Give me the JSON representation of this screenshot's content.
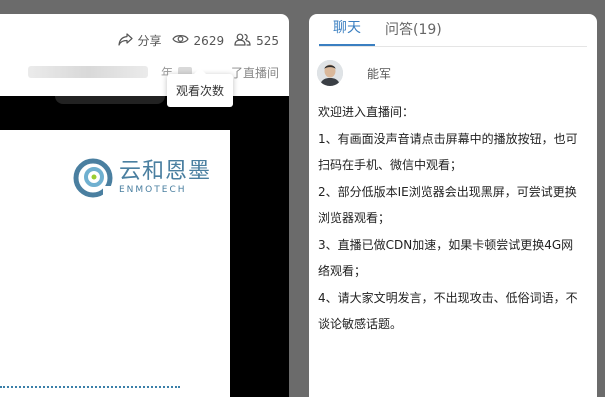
{
  "stats": {
    "share_label": "分享",
    "view_count": "2629",
    "participant_count": "525"
  },
  "tooltip": {
    "text": "观看次数"
  },
  "subline": {
    "partial_prefix": "年",
    "live_text": "了直播间"
  },
  "slide": {
    "logo_cn": "云和恩墨",
    "logo_en": "ENMOTECH"
  },
  "chat": {
    "tabs": [
      {
        "label": "聊天",
        "active": true
      },
      {
        "label": "问答(19)",
        "active": false
      }
    ],
    "user": {
      "name": "能军"
    },
    "messages": [
      "欢迎进入直播间：",
      "1、有画面没声音请点击屏幕中的播放按钮，也可扫码在手机、微信中观看；",
      "2、部分低版本IE浏览器会出现黑屏，可尝试更换浏览器观看；",
      "3、直播已做CDN加速，如果卡顿尝试更换4G网络观看；",
      "4、请大家文明发言，不出现攻击、低俗词语，不谈论敏感话题。"
    ]
  },
  "colors": {
    "accent": "#3a7fc1",
    "background": "#6b6b6b",
    "logo": "#4a7fa0"
  }
}
